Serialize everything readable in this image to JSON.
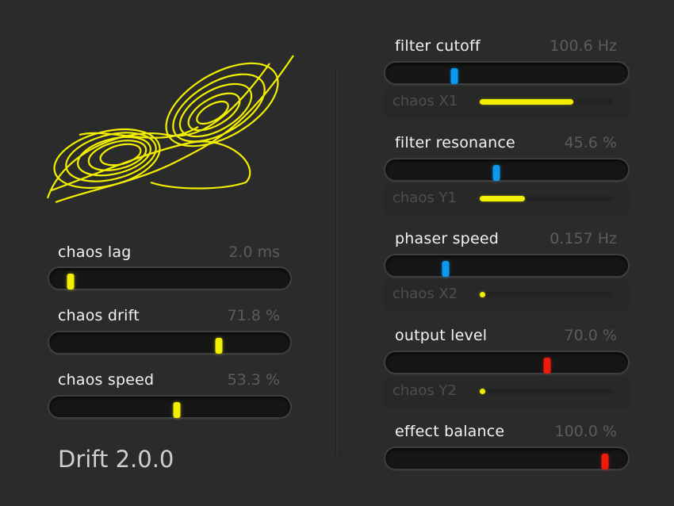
{
  "app": {
    "version_text": "Drift 2.0.0",
    "accent_yellow": "#f2ef00",
    "accent_blue": "#0a9af0",
    "accent_red": "#ee1a0c"
  },
  "visualizer": {
    "icon": "chaos-attractor",
    "color": "#f2ef00"
  },
  "left_params": [
    {
      "label": "chaos lag",
      "value": "2.0 ms",
      "position": 0.06
    },
    {
      "label": "chaos drift",
      "value": "71.8 %",
      "position": 0.718
    },
    {
      "label": "chaos speed",
      "value": "53.3 %",
      "position": 0.533
    }
  ],
  "right_params": [
    {
      "label": "filter cutoff",
      "value": "100.6 Hz",
      "position": 0.27,
      "color": "blue",
      "mod_label": "chaos X1",
      "mod_level": 0.7
    },
    {
      "label": "filter resonance",
      "value": "45.6 %",
      "position": 0.456,
      "color": "blue",
      "mod_label": "chaos Y1",
      "mod_level": 0.34
    },
    {
      "label": "phaser speed",
      "value": "0.157 Hz",
      "position": 0.23,
      "color": "blue",
      "mod_label": "chaos X2",
      "mod_level": 0.0
    },
    {
      "label": "output level",
      "value": "70.0 %",
      "position": 0.68,
      "color": "red",
      "mod_label": "chaos Y2",
      "mod_level": 0.0
    },
    {
      "label": "effect balance",
      "value": "100.0 %",
      "position": 0.935,
      "color": "red"
    }
  ]
}
